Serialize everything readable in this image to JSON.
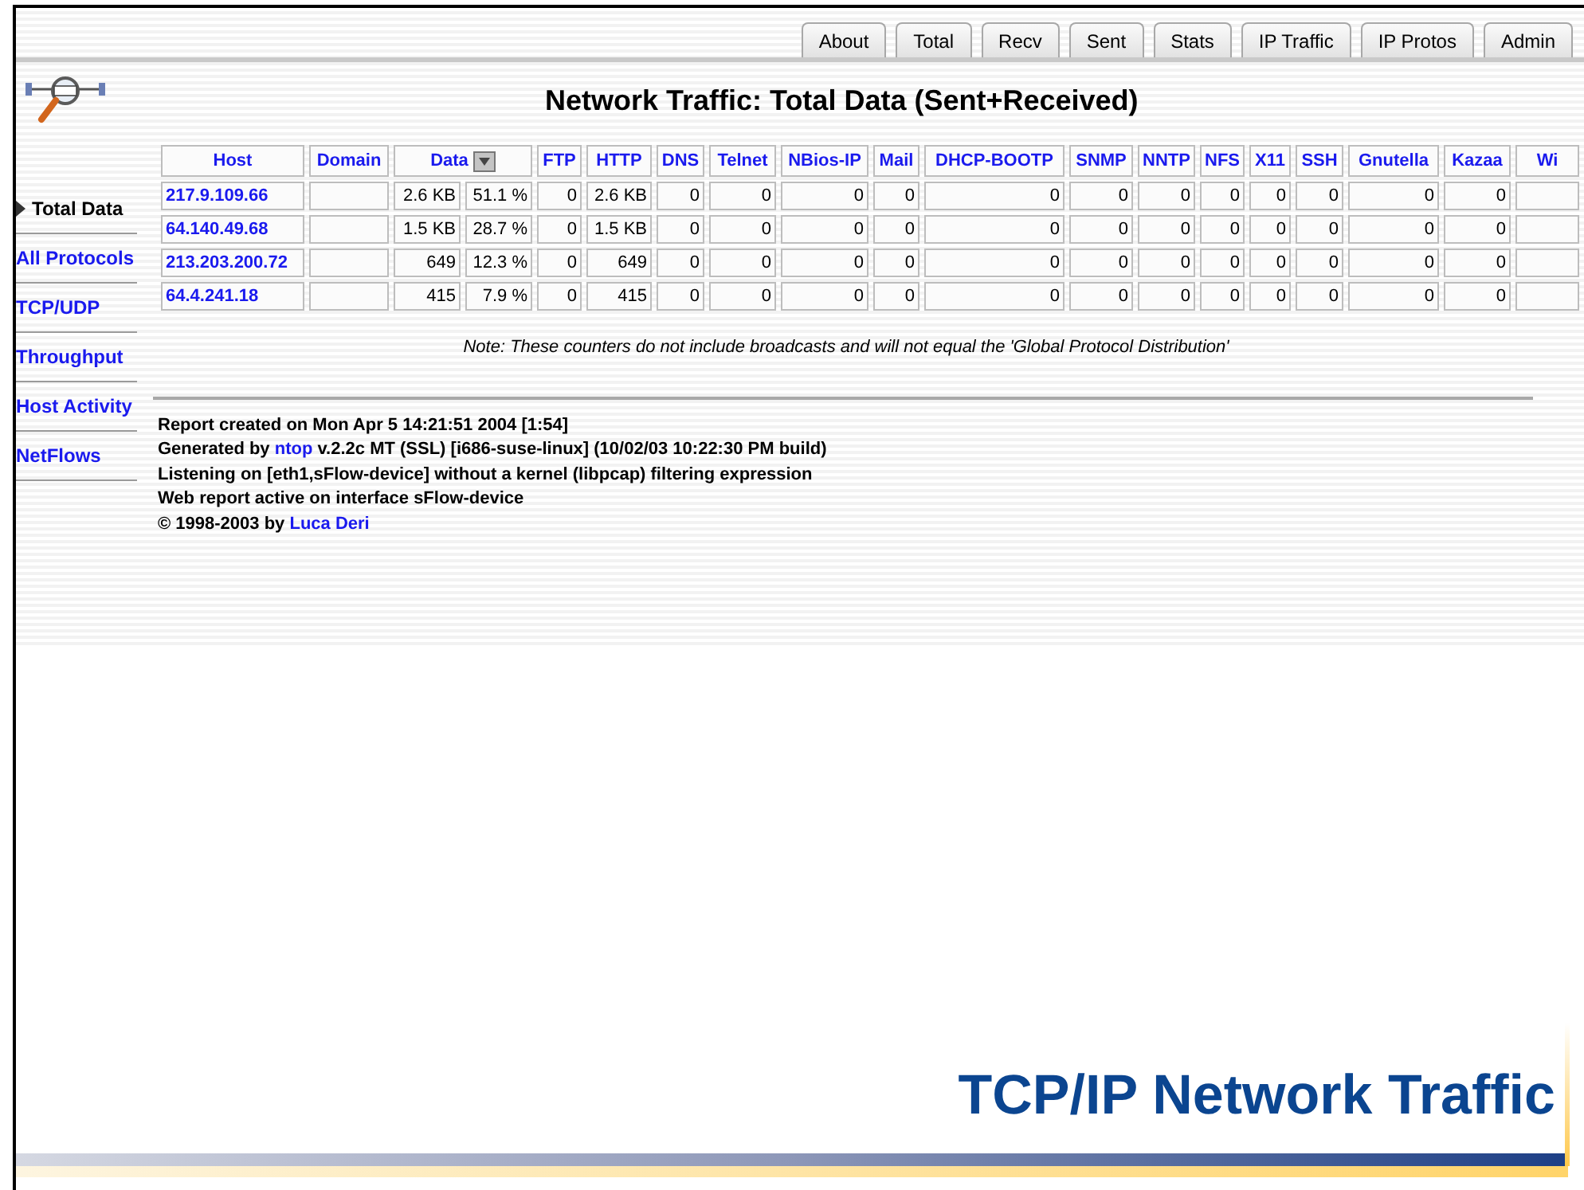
{
  "tabs": [
    {
      "label": "About"
    },
    {
      "label": "Total"
    },
    {
      "label": "Recv"
    },
    {
      "label": "Sent"
    },
    {
      "label": "Stats"
    },
    {
      "label": "IP Traffic"
    },
    {
      "label": "IP Protos"
    },
    {
      "label": "Admin"
    }
  ],
  "page_title": "Network Traffic: Total Data (Sent+Received)",
  "sidebar": {
    "items": [
      {
        "label": "Total Data",
        "selected": true
      },
      {
        "label": "All Protocols",
        "selected": false
      },
      {
        "label": "TCP/UDP",
        "selected": false
      },
      {
        "label": "Throughput",
        "selected": false
      },
      {
        "label": "Host Activity",
        "selected": false
      },
      {
        "label": "NetFlows",
        "selected": false
      }
    ]
  },
  "table": {
    "columns": [
      "Host",
      "Domain",
      "Data",
      "FTP",
      "HTTP",
      "DNS",
      "Telnet",
      "NBios-IP",
      "Mail",
      "DHCP-BOOTP",
      "SNMP",
      "NNTP",
      "NFS",
      "X11",
      "SSH",
      "Gnutella",
      "Kazaa",
      "Wi"
    ],
    "rows": [
      {
        "host": "217.9.109.66",
        "data": "2.6 KB",
        "share": "51.1 %",
        "protocols": [
          "0",
          "2.6 KB",
          "0",
          "0",
          "0",
          "0",
          "0",
          "0",
          "0",
          "0",
          "0",
          "0",
          "0",
          "0"
        ]
      },
      {
        "host": "64.140.49.68",
        "data": "1.5 KB",
        "share": "28.7 %",
        "protocols": [
          "0",
          "1.5 KB",
          "0",
          "0",
          "0",
          "0",
          "0",
          "0",
          "0",
          "0",
          "0",
          "0",
          "0",
          "0"
        ]
      },
      {
        "host": "213.203.200.72",
        "data": "649",
        "share": "12.3 %",
        "protocols": [
          "0",
          "649",
          "0",
          "0",
          "0",
          "0",
          "0",
          "0",
          "0",
          "0",
          "0",
          "0",
          "0",
          "0"
        ]
      },
      {
        "host": "64.4.241.18",
        "data": "415",
        "share": "7.9 %",
        "protocols": [
          "0",
          "415",
          "0",
          "0",
          "0",
          "0",
          "0",
          "0",
          "0",
          "0",
          "0",
          "0",
          "0",
          "0"
        ]
      }
    ]
  },
  "note": "Note: These counters do not include broadcasts and will not equal the 'Global Protocol Distribution'",
  "report_lines": [
    [
      {
        "kind": "text",
        "text": "Report created on Mon Apr 5 14:21:51 2004 [1:54]"
      }
    ],
    [
      {
        "kind": "text",
        "text": "Generated by "
      },
      {
        "kind": "link",
        "text": "ntop"
      },
      {
        "kind": "text",
        "text": " v.2.2c MT (SSL) [i686-suse-linux] (10/02/03 10:22:30 PM build)"
      }
    ],
    [
      {
        "kind": "text",
        "text": "Listening on [eth1,sFlow-device] without a kernel (libpcap) filtering expression"
      }
    ],
    [
      {
        "kind": "text",
        "text": "Web report active on interface sFlow-device"
      }
    ],
    [
      {
        "kind": "text",
        "text": "© 1998-2003 by "
      },
      {
        "kind": "link",
        "text": "Luca Deri"
      }
    ]
  ],
  "slide_title": "TCP/IP Network Traffic"
}
